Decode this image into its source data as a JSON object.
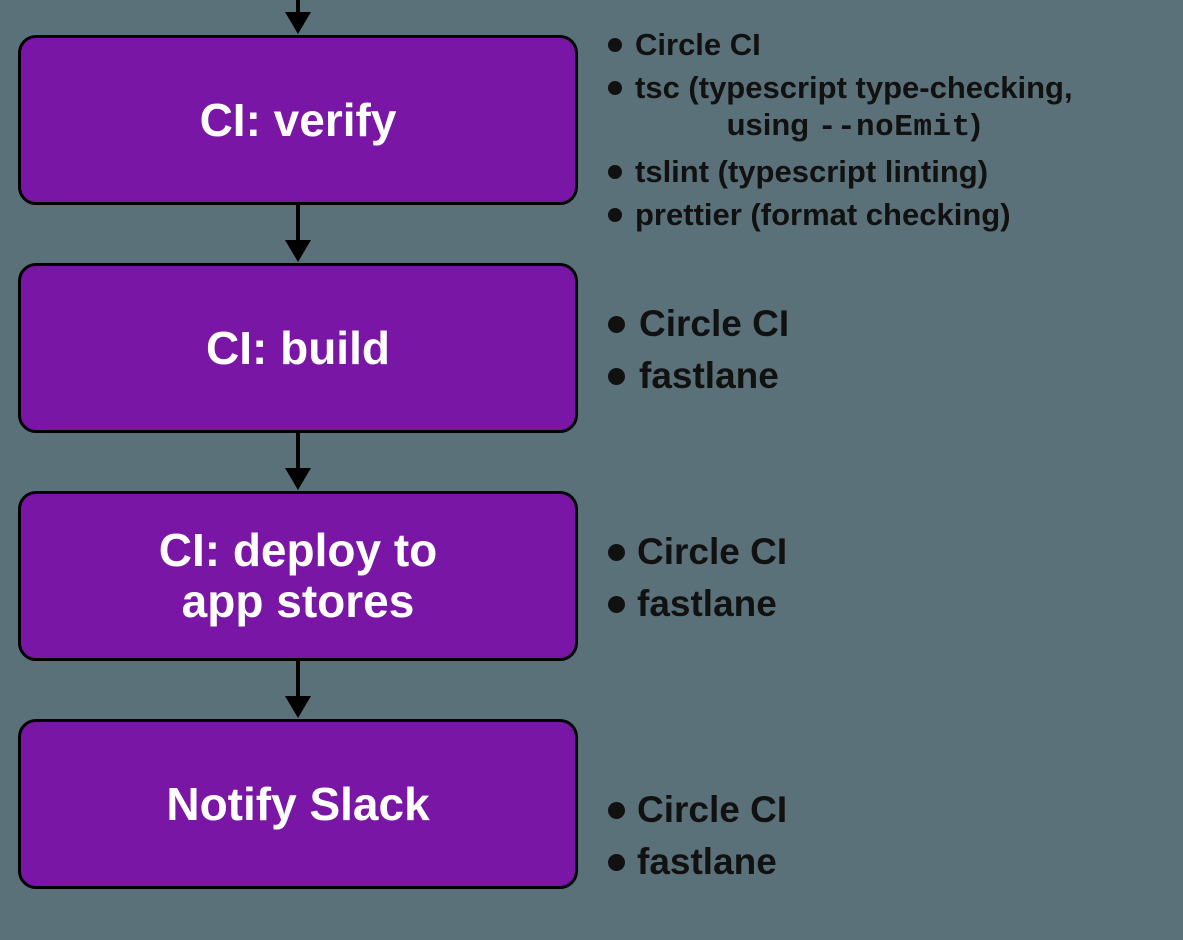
{
  "stages": [
    {
      "title_line1": "CI: verify",
      "title_line2": "",
      "bullets": [
        {
          "text": "Circle CI"
        },
        {
          "text_parts": [
            "tsc (typescript type-checking,",
            "using ",
            "--noEmit",
            ")"
          ],
          "has_mono": true
        },
        {
          "text": "tslint (typescript linting)"
        },
        {
          "text": "prettier (format checking)"
        }
      ]
    },
    {
      "title_line1": "CI: build",
      "title_line2": "",
      "bullets": [
        {
          "text": "Circle CI"
        },
        {
          "text": "fastlane"
        }
      ]
    },
    {
      "title_line1": "CI: deploy to",
      "title_line2": "app stores",
      "bullets": [
        {
          "text": "Circle CI"
        },
        {
          "text": "fastlane"
        }
      ]
    },
    {
      "title_line1": "Notify Slack",
      "title_line2": "",
      "bullets": [
        {
          "text": "Circle CI"
        },
        {
          "text": "fastlane"
        }
      ]
    }
  ]
}
